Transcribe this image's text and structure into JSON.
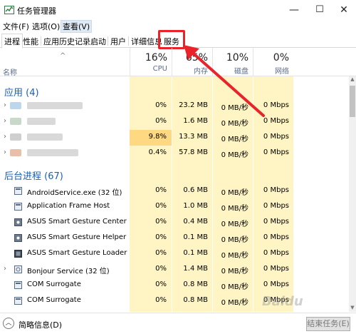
{
  "window": {
    "title": "任务管理器",
    "icon": "task-manager-icon",
    "controls": {
      "minimize": "—",
      "maximize": "☐",
      "close": "✕"
    }
  },
  "menu": [
    "文件(F)",
    "选项(O)",
    "查看(V)"
  ],
  "tabs": [
    "进程",
    "性能",
    "应用历史记录",
    "启动",
    "用户",
    "详细信息",
    "服务"
  ],
  "header": {
    "name": "名称",
    "sort_caret": "^",
    "cpu": {
      "pct": "16%",
      "label": "CPU"
    },
    "memory": {
      "pct": "65%",
      "label": "内存"
    },
    "disk": {
      "pct": "10%",
      "label": "磁盘"
    },
    "network": {
      "pct": "0%",
      "label": "网络"
    }
  },
  "groups": {
    "apps": "应用 (4)",
    "background": "后台进程 (67)"
  },
  "app_rows": [
    {
      "cpu": "0%",
      "mem": "23.2 MB",
      "disk": "0 MB/秒",
      "net": "0 Mbps"
    },
    {
      "cpu": "0%",
      "mem": "1.6 MB",
      "disk": "0 MB/秒",
      "net": "0 Mbps"
    },
    {
      "cpu": "9.8%",
      "mem": "13.3 MB",
      "disk": "0 MB/秒",
      "net": "0 Mbps"
    },
    {
      "cpu": "0.4%",
      "mem": "57.8 MB",
      "disk": "0 MB/秒",
      "net": "0 Mbps"
    }
  ],
  "bg_rows": [
    {
      "name": "AndroidService.exe (32 位)",
      "cpu": "0%",
      "mem": "0.6 MB",
      "disk": "0 MB/秒",
      "net": "0 Mbps"
    },
    {
      "name": "Application Frame Host",
      "cpu": "0%",
      "mem": "1.0 MB",
      "disk": "0 MB/秒",
      "net": "0 Mbps"
    },
    {
      "name": "ASUS Smart Gesture Center",
      "cpu": "0%",
      "mem": "0.4 MB",
      "disk": "0 MB/秒",
      "net": "0 Mbps"
    },
    {
      "name": "ASUS Smart Gesture Helper",
      "cpu": "0%",
      "mem": "0.1 MB",
      "disk": "0 MB/秒",
      "net": "0 Mbps"
    },
    {
      "name": "ASUS Smart Gesture Loader",
      "cpu": "0%",
      "mem": "0.1 MB",
      "disk": "0 MB/秒",
      "net": "0 Mbps"
    },
    {
      "name": "Bonjour Service (32 位)",
      "cpu": "0%",
      "mem": "1.4 MB",
      "disk": "0 MB/秒",
      "net": "0 Mbps"
    },
    {
      "name": "COM Surrogate",
      "cpu": "0%",
      "mem": "0.8 MB",
      "disk": "0 MB/秒",
      "net": "0 Mbps"
    },
    {
      "name": "COM Surrogate",
      "cpu": "0%",
      "mem": "0.8 MB",
      "disk": "0 MB/秒",
      "net": "0 Mbps"
    }
  ],
  "footer": {
    "fewer_details": "简略信息(D)",
    "end_task": "结束任务(E)"
  },
  "watermark": "Baidu",
  "colors": {
    "accent_group": "#1c5fb0",
    "cpu_heat": "#fff4c4",
    "cpu_hot": "#ffd982",
    "annotation_red": "#e8232a"
  }
}
